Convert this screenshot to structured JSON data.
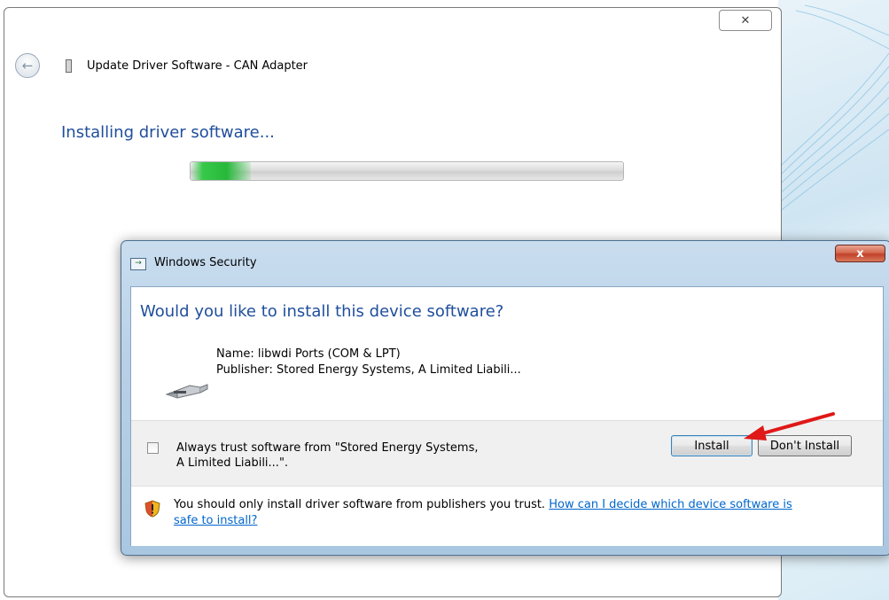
{
  "wizard": {
    "title": "Update Driver Software - CAN Adapter",
    "close_glyph": "✕",
    "back_glyph": "←",
    "heading": "Installing driver software...",
    "progress_fraction": 0.14
  },
  "dialog": {
    "title": "Windows Security",
    "close_glyph": "x",
    "question": "Would you like to install this device software?",
    "name_line": "Name: libwdi Ports (COM & LPT)",
    "publisher_line": "Publisher: Stored Energy Systems, A Limited Liabili...",
    "trust_line1": "Always trust software from \"Stored Energy Systems,",
    "trust_line2": "A Limited Liabili...\".",
    "install_label": "Install",
    "dont_install_label": "Don't Install",
    "warning_text": "You should only install driver software from publishers you trust.",
    "warning_link_part1": "How can I decide which device software is",
    "warning_link_part2": "safe to install?"
  },
  "colors": {
    "heading_blue": "#1f4e9c",
    "link_blue": "#0066cc",
    "progress_green": "#37c94a",
    "annotation_red": "#e01818"
  }
}
